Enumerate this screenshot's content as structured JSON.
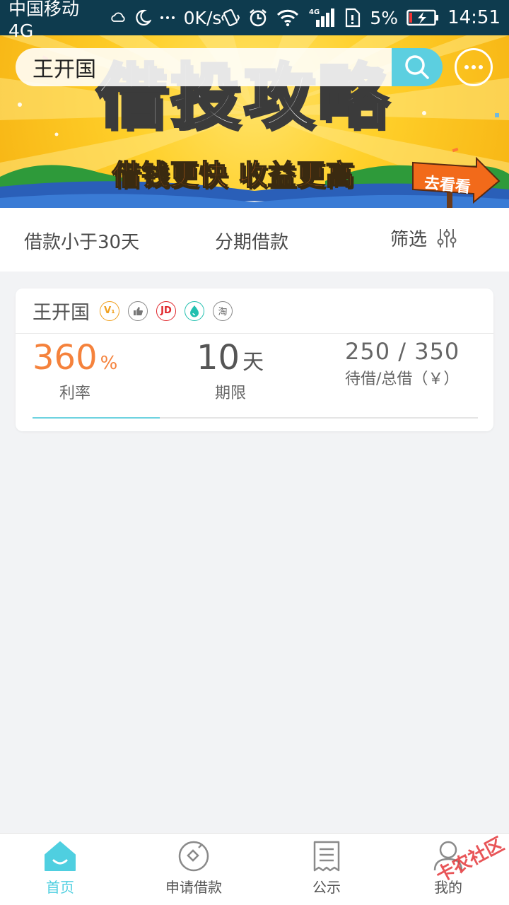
{
  "status_bar": {
    "carrier": "中国移动4G",
    "network_speed": "0K/s",
    "battery": "5%",
    "time": "14:51",
    "icons": [
      "weather-icon",
      "moon-icon",
      "more-dots-icon",
      "vibrate-icon",
      "alarm-icon",
      "wifi-icon",
      "signal-4g-icon",
      "sim-icon",
      "battery-charging-icon"
    ]
  },
  "search": {
    "value": "王开国",
    "placeholder": ""
  },
  "banner": {
    "title": "借投攻略",
    "subtitle": "借钱更快 收益更高",
    "cta": "去看看",
    "slides_count": 6,
    "active_slide": 6
  },
  "filters": {
    "items": [
      {
        "label": "借款小于30天"
      },
      {
        "label": "分期借款"
      },
      {
        "label": "筛选",
        "icon": "filter-sliders-icon"
      }
    ]
  },
  "loan_card": {
    "name": "王开国",
    "badges": [
      {
        "icon": "v1-verified-icon",
        "text": "V₁",
        "color": "#f0a020"
      },
      {
        "icon": "thumbs-up-icon",
        "text": "👍",
        "color": "#888888"
      },
      {
        "icon": "jd-icon",
        "text": "JD",
        "color": "#e0262b"
      },
      {
        "icon": "drop-icon",
        "text": "",
        "color": "#22c0b0"
      },
      {
        "icon": "taobao-icon",
        "text": "淘",
        "color": "#777777"
      }
    ],
    "rate": {
      "value": "360",
      "unit": "%",
      "label": "利率"
    },
    "term": {
      "value": "10",
      "unit": "天",
      "label": "期限"
    },
    "amount": {
      "value": "250 / 350",
      "label": "待借/总借（￥）"
    },
    "progress": 0.2857
  },
  "bottom_nav": {
    "items": [
      {
        "label": "首页",
        "icon": "home-icon",
        "active": true
      },
      {
        "label": "申请借款",
        "icon": "apply-loan-icon",
        "active": false
      },
      {
        "label": "公示",
        "icon": "notice-icon",
        "active": false
      },
      {
        "label": "我的",
        "icon": "profile-icon",
        "active": false
      }
    ]
  },
  "watermark": "卡农社区",
  "colors": {
    "accent": "#5ccfe0",
    "rate_orange": "#f5823c",
    "status_bar": "#0e3b4e",
    "banner_yellow": "#ffd02a"
  }
}
